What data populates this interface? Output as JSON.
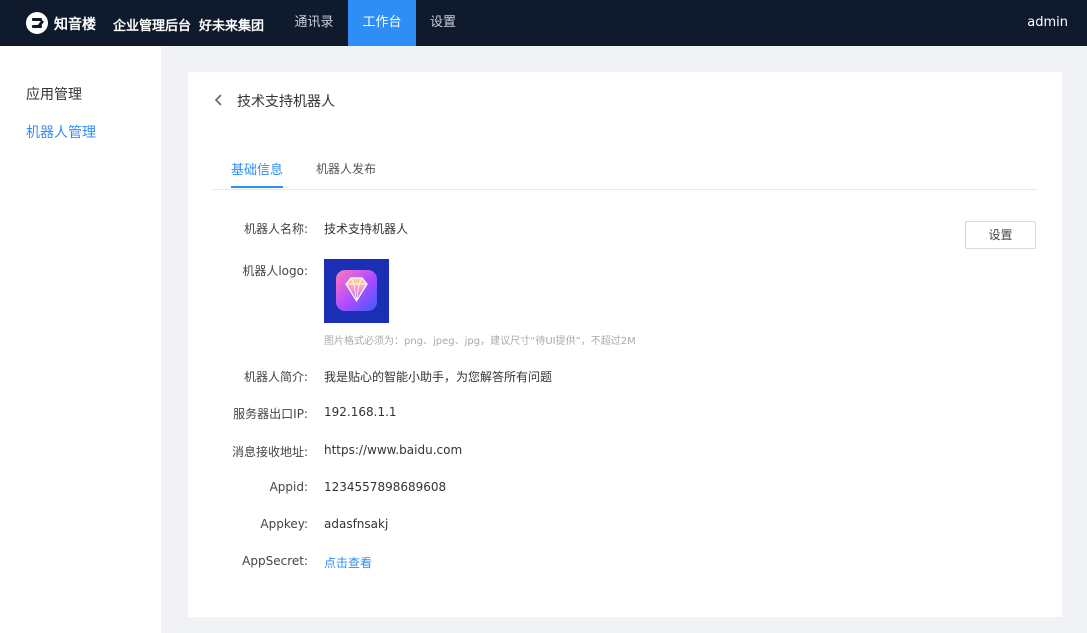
{
  "topbar": {
    "brand": "知音楼",
    "tenant": "企业管理后台",
    "org": "好未来集团",
    "nav": {
      "contacts": "通讯录",
      "workbench": "工作台",
      "settings": "设置"
    },
    "user": "admin",
    "accent": "#2f8ef5",
    "background": "#0f1a2c"
  },
  "sidebar": {
    "items": [
      "应用管理",
      "机器人管理"
    ],
    "active_index": 1
  },
  "page": {
    "title": "技术支持机器人",
    "tabs": [
      "基础信息",
      "机器人发布"
    ],
    "active_tab": 0,
    "settings_button": "设置",
    "fields": {
      "name": {
        "label": "机器人名称:",
        "value": "技术支持机器人"
      },
      "logo": {
        "label": "机器人logo:",
        "hint": "图片格式必须为：png、jpeg、jpg，建议尺寸“待UI提供”，不超过2M",
        "icon": "diamond-app-icon"
      },
      "intro": {
        "label": "机器人简介:",
        "value": "我是贴心的智能小助手，为您解答所有问题"
      },
      "ip": {
        "label": "服务器出口IP:",
        "value": "192.168.1.1"
      },
      "url": {
        "label": "消息接收地址:",
        "value": "https://www.baidu.com"
      },
      "appid": {
        "label": "Appid:",
        "value": "1234557898689608"
      },
      "appkey": {
        "label": "Appkey:",
        "value": "adasfnsakj"
      },
      "appsecret": {
        "label": "AppSecret:",
        "value": "点击查看"
      }
    }
  }
}
